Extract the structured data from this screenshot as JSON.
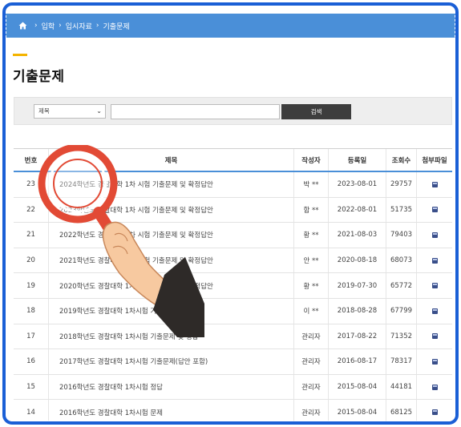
{
  "breadcrumb": {
    "items": [
      "입학",
      "입시자료",
      "기출문제"
    ]
  },
  "page_title": "기출문제",
  "search": {
    "select_value": "제목",
    "input_value": "",
    "button_label": "검색"
  },
  "table": {
    "headers": {
      "num": "번호",
      "title": "제목",
      "author": "작성자",
      "date": "등록일",
      "views": "조회수",
      "file": "첨부파일"
    },
    "rows": [
      {
        "num": "23",
        "title": "2024학년도 경찰대학 1차 시험 기출문제 및 확정답안",
        "author": "박 **",
        "date": "2023-08-01",
        "views": "29757"
      },
      {
        "num": "22",
        "title": "2023학년도 경찰대학 1차 시험 기출문제 및 확정답안",
        "author": "함 **",
        "date": "2022-08-01",
        "views": "51735"
      },
      {
        "num": "21",
        "title": "2022학년도 경찰대학 1차 시험 기출문제 및 확정답안",
        "author": "황 **",
        "date": "2021-08-03",
        "views": "79403"
      },
      {
        "num": "20",
        "title": "2021학년도 경찰대학 1차 시험 기출문제 및 확정답안",
        "author": "안 **",
        "date": "2020-08-18",
        "views": "68073"
      },
      {
        "num": "19",
        "title": "2020학년도 경찰대학 1차 시험 기출문제 및 확정답안",
        "author": "황 **",
        "date": "2019-07-30",
        "views": "65772"
      },
      {
        "num": "18",
        "title": "2019학년도 경찰대학 1차시험 기출문제 및 정답",
        "author": "이 **",
        "date": "2018-08-28",
        "views": "67799"
      },
      {
        "num": "17",
        "title": "2018학년도 경찰대학 1차시험 기출문제 및 정답",
        "author": "관리자",
        "date": "2017-08-22",
        "views": "71352"
      },
      {
        "num": "16",
        "title": "2017학년도 경찰대학 1차시험 기출문제(답안 포함)",
        "author": "관리자",
        "date": "2016-08-17",
        "views": "78317"
      },
      {
        "num": "15",
        "title": "2016학년도 경찰대학 1차시험 정답",
        "author": "관리자",
        "date": "2015-08-04",
        "views": "44181"
      },
      {
        "num": "14",
        "title": "2016학년도 경찰대학 1차시험 문제",
        "author": "관리자",
        "date": "2015-08-04",
        "views": "68125"
      }
    ]
  },
  "icons": {
    "home": "home-icon",
    "file": "file-icon",
    "overlay": "magnifier-hand-icon"
  },
  "colors": {
    "header_bar": "#4a8fd8",
    "accent": "#f4b400",
    "frame": "#1a5fd6",
    "search_button": "#3d3d3d"
  }
}
